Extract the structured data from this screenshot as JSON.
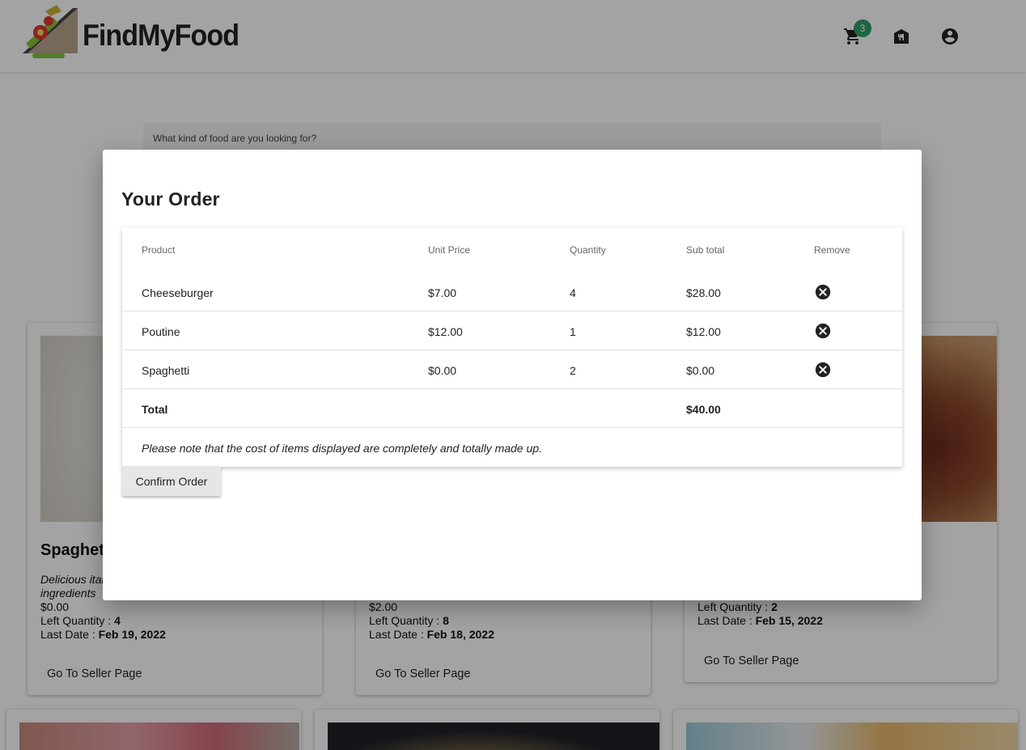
{
  "header": {
    "brand": "FindMyFood",
    "cart_count": "3",
    "icons": [
      "logo-icon",
      "cart-icon",
      "restaurant-icon",
      "account-icon"
    ]
  },
  "search": {
    "label": "What kind of food are you looking for?"
  },
  "cards": [
    {
      "title": "Spaghetti",
      "description": "Delicious italian spaghetti made with fresh ingredients",
      "price": "$0.00",
      "left_quantity_label": "Left Quantity : ",
      "left_quantity": "4",
      "last_date_label": "Last Date : ",
      "last_date": "Feb 19, 2022",
      "button": "Go To Seller Page"
    },
    {
      "price": "$2.00",
      "left_quantity_label": "Left Quantity : ",
      "left_quantity": "8",
      "last_date_label": "Last Date : ",
      "last_date": "Feb 18, 2022",
      "button": "Go To Seller Page"
    },
    {
      "left_quantity_label": "Left Quantity : ",
      "left_quantity": "2",
      "last_date_label": "Last Date : ",
      "last_date": "Feb 15, 2022",
      "button": "Go To Seller Page"
    }
  ],
  "modal": {
    "title": "Your Order",
    "columns": [
      "Product",
      "Unit Price",
      "Quantity",
      "Sub total",
      "Remove"
    ],
    "rows": [
      {
        "product": "Cheeseburger",
        "unit_price": "$7.00",
        "quantity": "4",
        "subtotal": "$28.00"
      },
      {
        "product": "Poutine",
        "unit_price": "$12.00",
        "quantity": "1",
        "subtotal": "$12.00"
      },
      {
        "product": "Spaghetti",
        "unit_price": "$0.00",
        "quantity": "2",
        "subtotal": "$0.00"
      }
    ],
    "total_label": "Total",
    "total_value": "$40.00",
    "note": "Please note that the cost of items displayed are completely and totally made up.",
    "confirm_label": "Confirm Order"
  }
}
